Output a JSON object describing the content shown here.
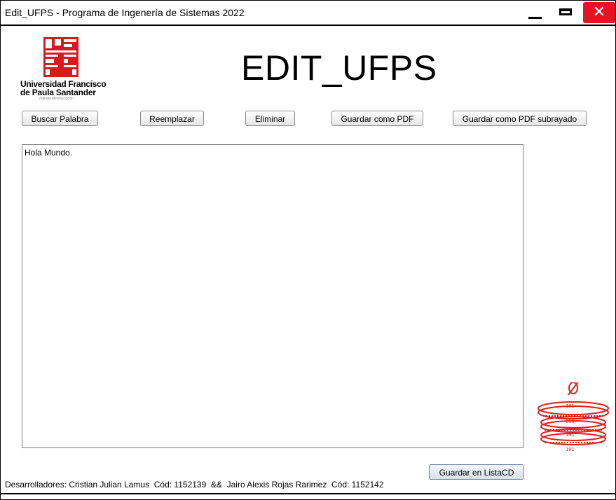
{
  "window": {
    "title": "Edit_UFPS - Programa de Ingenería de Sistemas 2022",
    "controls": {
      "minimize_icon": "minimize-icon",
      "maximize_icon": "maximize-icon",
      "close_icon": "close-icon",
      "close_glyph": "✕"
    }
  },
  "logo": {
    "line1": "Universidad Francisco",
    "line2": "de Paula Santander",
    "line3": "Vigilada Mineducación",
    "brand_color": "#d71920"
  },
  "header": {
    "title": "EDIT_UFPS"
  },
  "toolbar": {
    "search_label": "Buscar Palabra",
    "replace_label": "Reemplazar",
    "delete_label": "Eliminar",
    "pdf_label": "Guardar como PDF",
    "pdf_underline_label": "Guardar como PDF subrayado"
  },
  "editor": {
    "content": "Hola Mundo."
  },
  "decoration": {
    "icon": "stacked-discs-icon",
    "color": "#e01e1e"
  },
  "actions": {
    "save_list_label": "Guardar en ListaCD"
  },
  "footer": {
    "credits": "Desarrolladores: Cristian Julian Lamus  Cód: 1152139  &&  Jairo Alexis Rojas Rarimez  Cód: 1152142"
  }
}
